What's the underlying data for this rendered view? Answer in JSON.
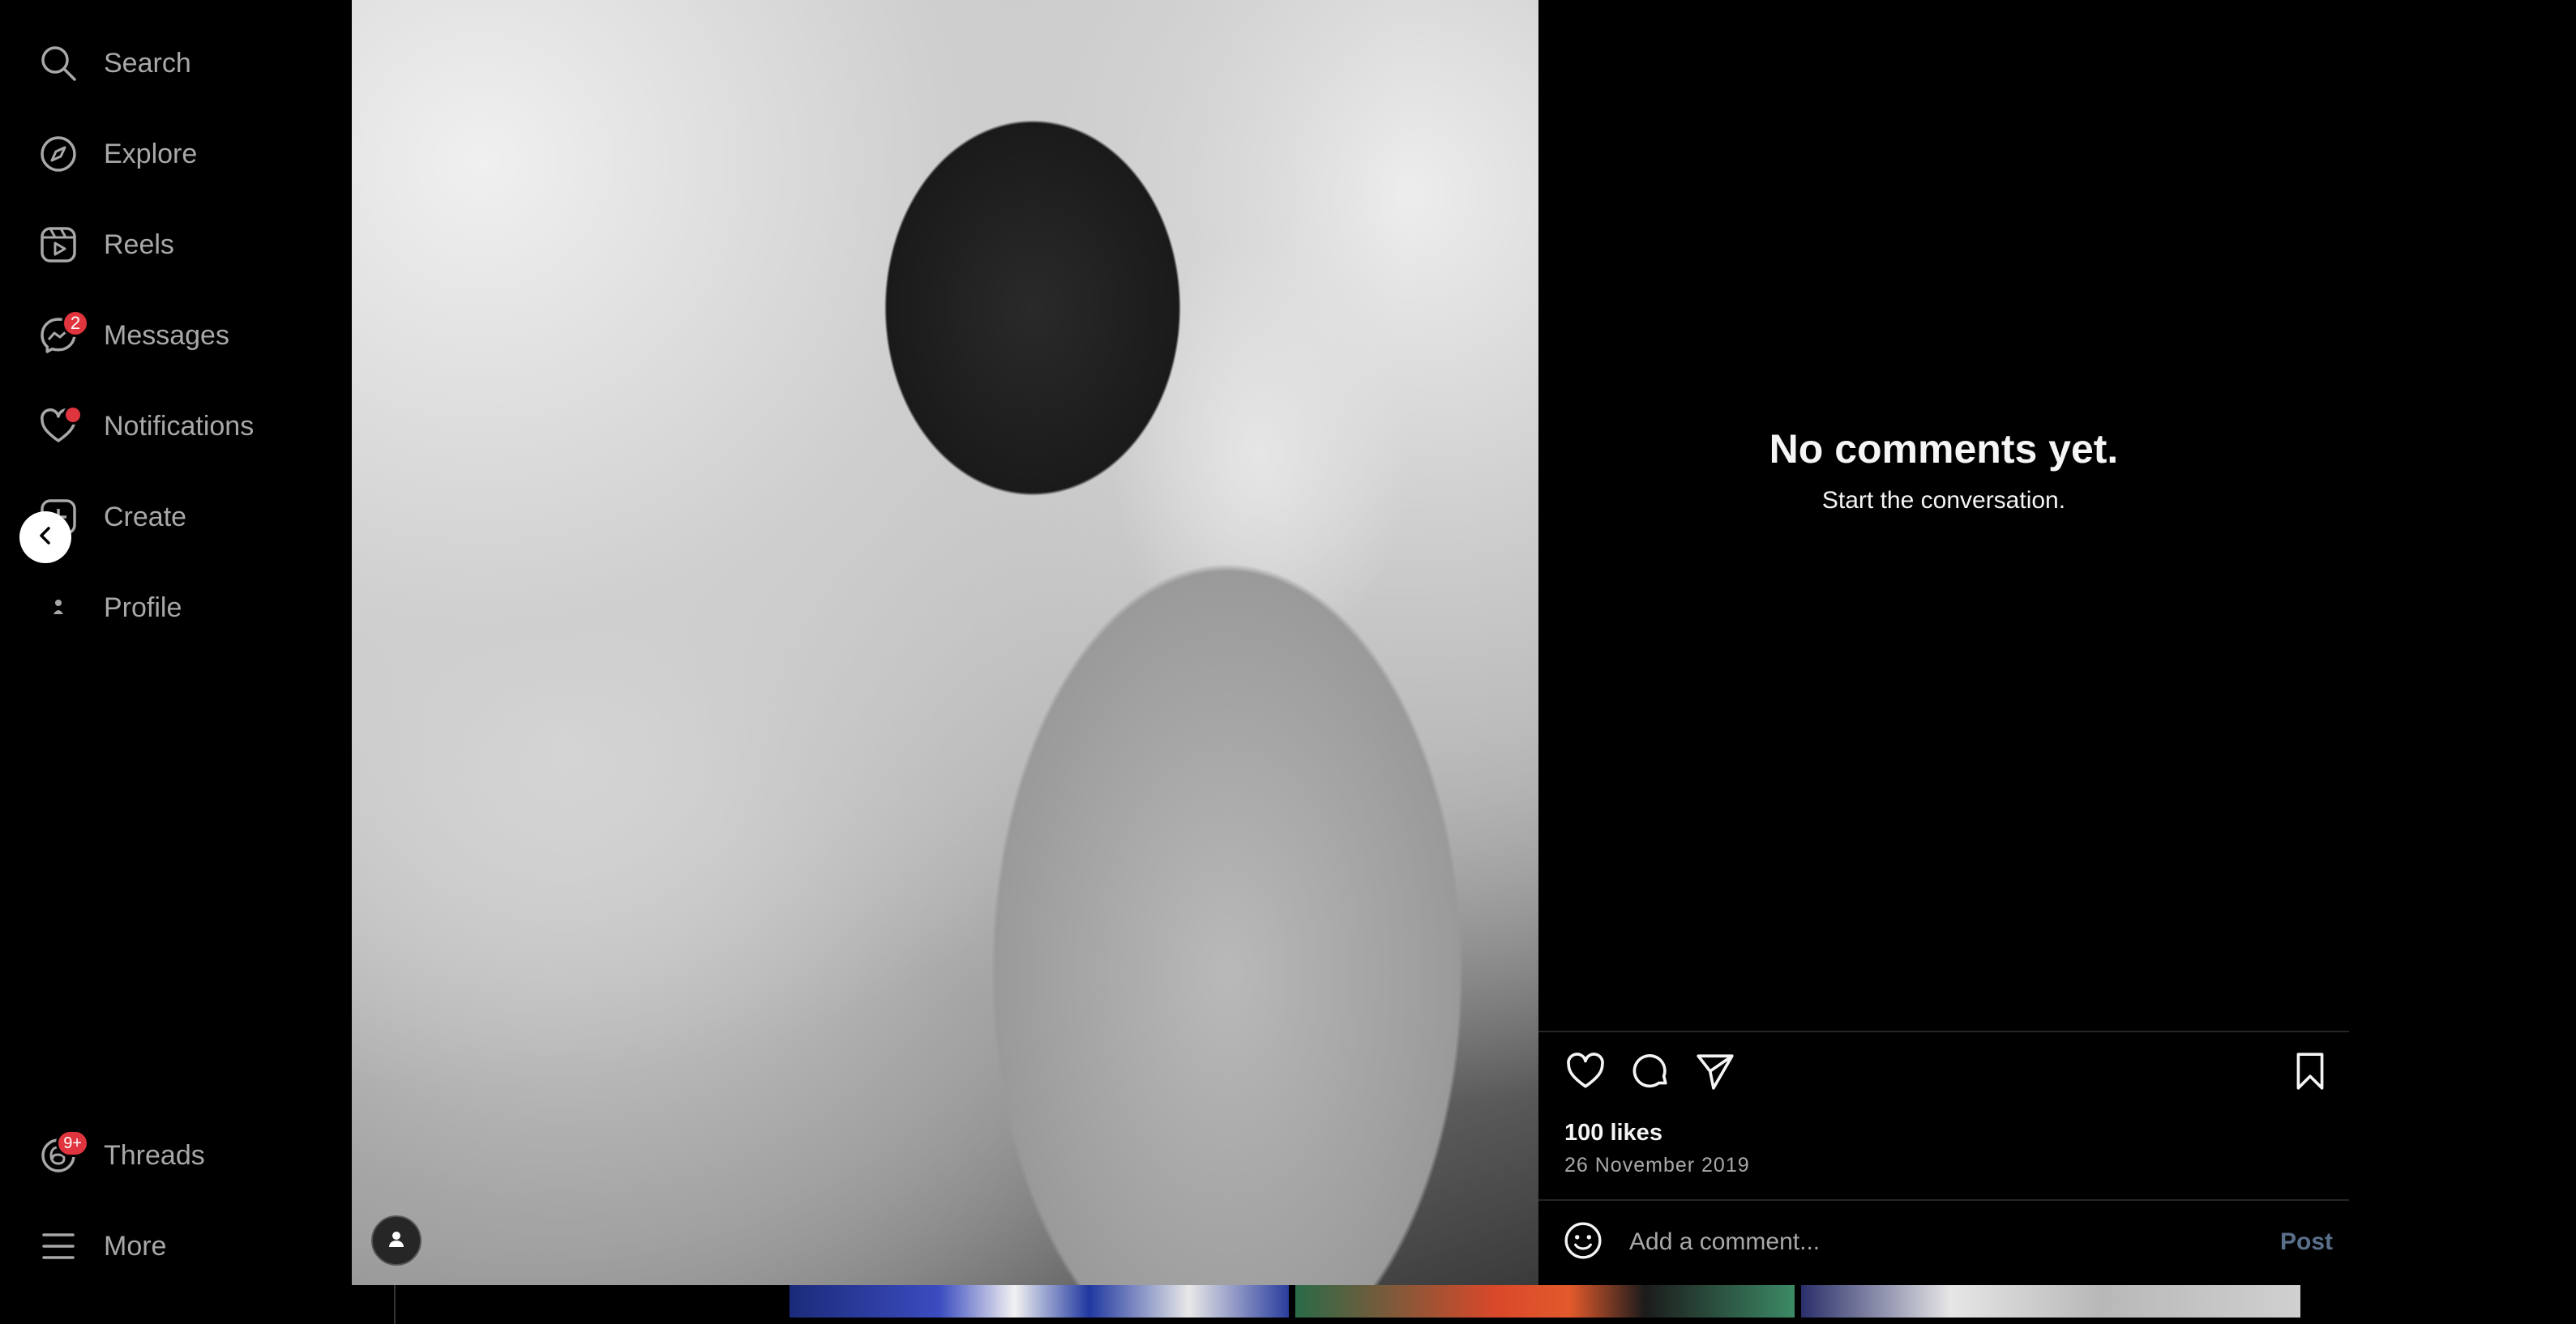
{
  "sidebar": {
    "items": [
      {
        "label": "Search",
        "icon": "search-icon"
      },
      {
        "label": "Explore",
        "icon": "compass-icon"
      },
      {
        "label": "Reels",
        "icon": "reels-icon"
      },
      {
        "label": "Messages",
        "icon": "messenger-icon",
        "badge": "2"
      },
      {
        "label": "Notifications",
        "icon": "heart-icon",
        "dot": true
      },
      {
        "label": "Create",
        "icon": "plus-square-icon"
      },
      {
        "label": "Profile",
        "icon": "profile-icon"
      }
    ],
    "bottom_items": [
      {
        "label": "Threads",
        "icon": "threads-icon",
        "badge": "9+"
      },
      {
        "label": "More",
        "icon": "menu-icon"
      }
    ]
  },
  "post": {
    "empty_title": "No comments yet.",
    "empty_subtitle": "Start the conversation.",
    "likes": "100 likes",
    "date": "26 November 2019",
    "comment_placeholder": "Add a comment...",
    "post_label": "Post"
  },
  "colors": {
    "background": "#000000",
    "text_primary": "#f5f5f5",
    "text_secondary": "#a8a8a8",
    "badge": "#e0343e",
    "post_button_disabled": "#5a6f8a"
  }
}
